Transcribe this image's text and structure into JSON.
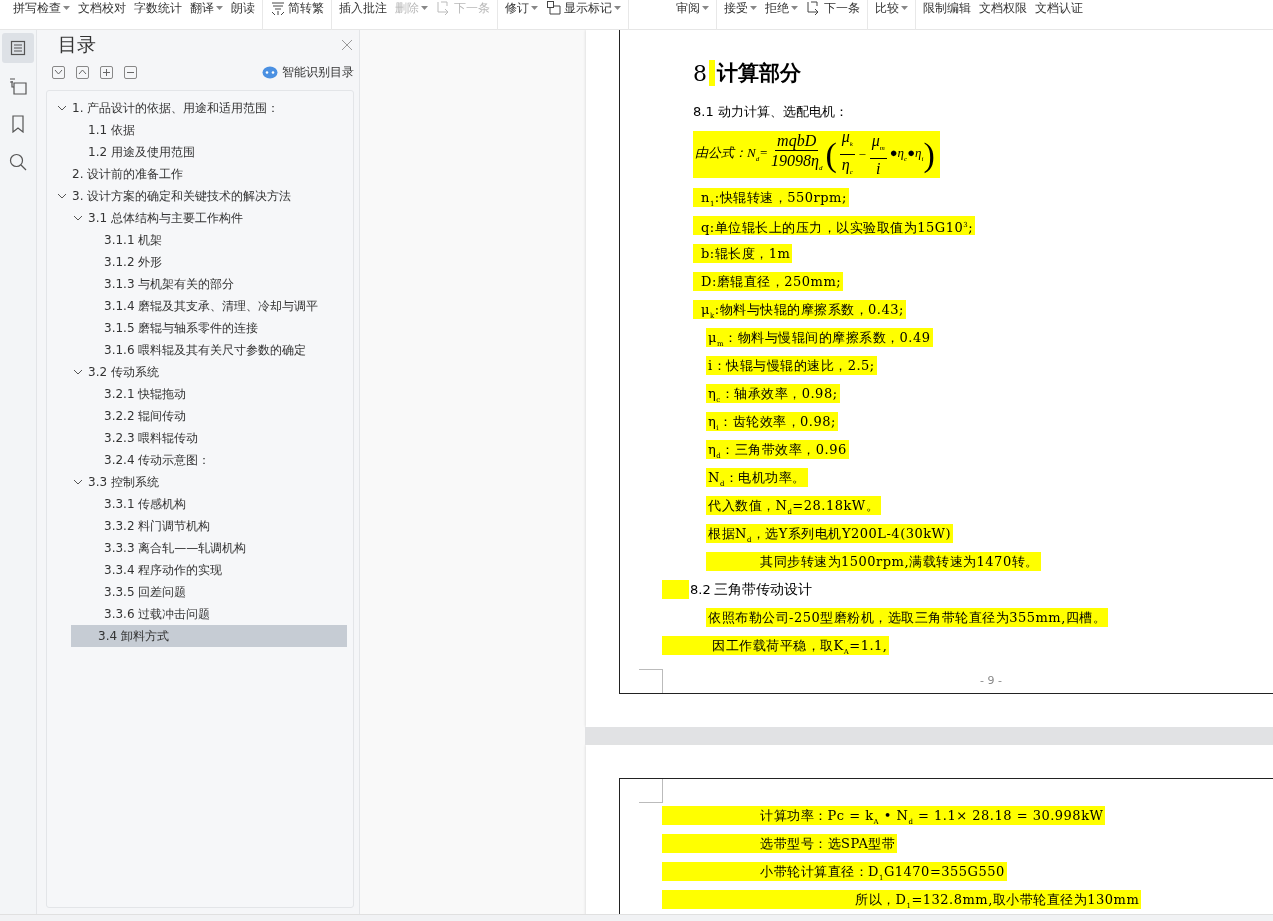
{
  "toolbar": {
    "groups": [
      {
        "items": [
          {
            "label": "拼写检查",
            "dropdown": true,
            "disabled": false,
            "kind": "text"
          },
          {
            "label": "文档校对",
            "dropdown": false,
            "disabled": false,
            "kind": "text"
          },
          {
            "label": "字数统计",
            "dropdown": false,
            "disabled": false,
            "kind": "text"
          },
          {
            "label": "翻译",
            "dropdown": true,
            "disabled": false,
            "kind": "text"
          },
          {
            "label": "朗读",
            "dropdown": false,
            "disabled": false,
            "kind": "text"
          }
        ]
      },
      {
        "items": [
          {
            "label": "简转繁",
            "dropdown": false,
            "disabled": false,
            "kind": "convert"
          }
        ]
      },
      {
        "items": [
          {
            "label": "插入批注",
            "dropdown": false,
            "disabled": false,
            "kind": "text"
          },
          {
            "label": "删除",
            "dropdown": true,
            "disabled": true,
            "kind": "text"
          },
          {
            "label": "下一条",
            "dropdown": false,
            "disabled": true,
            "kind": "next"
          }
        ]
      },
      {
        "items": [
          {
            "label": "修订",
            "dropdown": true,
            "disabled": false,
            "kind": "text"
          },
          {
            "label": "显示标记",
            "dropdown": true,
            "disabled": false,
            "kind": "markup"
          }
        ]
      },
      {
        "items": [
          {
            "label": "审阅",
            "dropdown": true,
            "disabled": false,
            "kind": "text"
          }
        ]
      },
      {
        "items": [
          {
            "label": "接受",
            "dropdown": true,
            "disabled": false,
            "kind": "text"
          },
          {
            "label": "拒绝",
            "dropdown": true,
            "disabled": false,
            "kind": "text"
          },
          {
            "label": "下一条",
            "dropdown": false,
            "disabled": false,
            "kind": "next"
          }
        ]
      },
      {
        "items": [
          {
            "label": "比较",
            "dropdown": true,
            "disabled": false,
            "kind": "text"
          }
        ]
      },
      {
        "items": [
          {
            "label": "限制编辑",
            "dropdown": false,
            "disabled": false,
            "kind": "text"
          },
          {
            "label": "文档权限",
            "dropdown": false,
            "disabled": false,
            "kind": "text"
          },
          {
            "label": "文档认证",
            "dropdown": false,
            "disabled": false,
            "kind": "text"
          }
        ]
      }
    ]
  },
  "rail": [
    {
      "kind": "toc",
      "selected": true
    },
    {
      "kind": "outline",
      "selected": false
    },
    {
      "kind": "bookmark",
      "selected": false
    },
    {
      "kind": "search",
      "selected": false
    }
  ],
  "toc_panel": {
    "title": "目录",
    "smart_button": "智能识别目录",
    "tree": [
      {
        "label": "1.  产品设计的依据、用途和适用范围：",
        "selected": false,
        "expanded": true,
        "children": [
          {
            "label": "1.1  依据",
            "selected": false
          },
          {
            "label": "1.2  用途及使用范围",
            "selected": false
          }
        ]
      },
      {
        "label": "2.  设计前的准备工作",
        "selected": false
      },
      {
        "label": "3.  设计方案的确定和关键技术的解决方法",
        "selected": false,
        "expanded": true,
        "children": [
          {
            "label": "3.1  总体结构与主要工作构件",
            "selected": false,
            "expanded": true,
            "children": [
              {
                "label": "3.1.1  机架",
                "selected": false
              },
              {
                "label": "3.1.2  外形",
                "selected": false
              },
              {
                "label": "3.1.3  与机架有关的部分",
                "selected": false
              },
              {
                "label": "3.1.4  磨辊及其支承、清理、冷却与调平",
                "selected": false
              },
              {
                "label": "3.1.5  磨辊与轴系零件的连接",
                "selected": false
              },
              {
                "label": "3.1.6  喂料辊及其有关尺寸参数的确定",
                "selected": false
              }
            ]
          },
          {
            "label": "3.2    传动系统",
            "selected": false,
            "expanded": true,
            "children": [
              {
                "label": "3.2.1  快辊拖动",
                "selected": false
              },
              {
                "label": "3.2.2  辊间传动",
                "selected": false
              },
              {
                "label": "3.2.3    喂料辊传动",
                "selected": false
              },
              {
                "label": "3.2.4  传动示意图：",
                "selected": false
              }
            ]
          },
          {
            "label": "3.3  控制系统",
            "selected": false,
            "expanded": true,
            "children": [
              {
                "label": "3.3.1  传感机构",
                "selected": false
              },
              {
                "label": "3.3.2  料门调节机构",
                "selected": false
              },
              {
                "label": "3.3.3    离合轧——轧调机构",
                "selected": false
              },
              {
                "label": "3.3.4    程序动作的实现",
                "selected": false
              },
              {
                "label": "3.3.5    回差问题",
                "selected": false
              },
              {
                "label": "3.3.6    过载冲击问题",
                "selected": false
              }
            ]
          },
          {
            "label": "3.4  卸料方式",
            "selected": true
          }
        ]
      }
    ]
  },
  "pages": [
    {
      "footer": "- 9 -",
      "lines": [
        {
          "kind": "heading",
          "number": "8",
          "text": "计算部分"
        },
        {
          "kind": "subheading",
          "text": "8.1  动力计算、选配电机："
        },
        {
          "kind": "formula",
          "parts": [
            {
              "kind": "text",
              "s": "由公式：N$_{d}$="
            },
            {
              "kind": "frac",
              "num": "mqbD",
              "den": "19098η$_{d}$"
            },
            {
              "kind": "paren",
              "s": "("
            },
            {
              "kind": "frac",
              "num": "μ$_{k}$",
              "den": "η$_{c}$"
            },
            {
              "kind": "text",
              "s": "−"
            },
            {
              "kind": "frac",
              "num": "μ$_{m}$",
              "den": "i"
            },
            {
              "kind": "text",
              "s": "●η$_{c}$●η$_{i}$"
            },
            {
              "kind": "paren",
              "s": ")"
            }
          ]
        },
        {
          "kind": "item",
          "text": "n$_{1}$:快辊转速，550rpm;"
        },
        {
          "kind": "item",
          "text": "q:单位辊长上的压力，以实验取值为15G10$^{3}$;"
        },
        {
          "kind": "item",
          "text": "b:辊长度，1m"
        },
        {
          "kind": "item",
          "text": "D:磨辊直径，250mm;"
        },
        {
          "kind": "item",
          "text": "μ$_{k}$:物料与快辊的摩擦系数，0.43;"
        },
        {
          "kind": "subitem",
          "text": "μ$_{m}$：物料与慢辊间的摩擦系数，0.49"
        },
        {
          "kind": "subitem",
          "text": "i：快辊与慢辊的速比，2.5;"
        },
        {
          "kind": "subitem",
          "text": "η$_{c}$：轴承效率，0.98;"
        },
        {
          "kind": "subitem",
          "text": "η$_{i}$：齿轮效率，0.98;"
        },
        {
          "kind": "subitem",
          "text": "η$_{d}$：三角带效率，0.96"
        },
        {
          "kind": "subitem",
          "text": "N$_{d}$：电机功率。"
        },
        {
          "kind": "subitem",
          "text": "代入数值，N$_{d}$=28.18kW。"
        },
        {
          "kind": "subitem",
          "text": "根据N$_{d}$，选Y系列电机Y200L-4(30kW)"
        },
        {
          "kind": "subitem-indented",
          "text": "其同步转速为1500rpm,满载转速为1470转。"
        },
        {
          "kind": "section",
          "number": "8.2",
          "text": "三角带传动设计"
        },
        {
          "kind": "subitem",
          "text": "依照布勒公司-250型磨粉机，选取三角带轮直径为355mm,四槽。"
        },
        {
          "kind": "block",
          "text": "因工作载荷平稳，取K$_{A}$=1.1,"
        }
      ]
    },
    {
      "lines": [
        {
          "kind": "block-mid",
          "text": "计算功率：Pc = k$_{A}$ • N$_{d}$ = 1.1× 28.18 = 30.998kW"
        },
        {
          "kind": "block-mid",
          "text": "选带型号：选SPA型带"
        },
        {
          "kind": "block-mid",
          "text": "小带轮计算直径：D$_{1}$G1470=355G550"
        },
        {
          "kind": "block-far",
          "text": "所以，D$_{1}$=132.8mm,取小带轮直径为130mm"
        }
      ]
    }
  ]
}
